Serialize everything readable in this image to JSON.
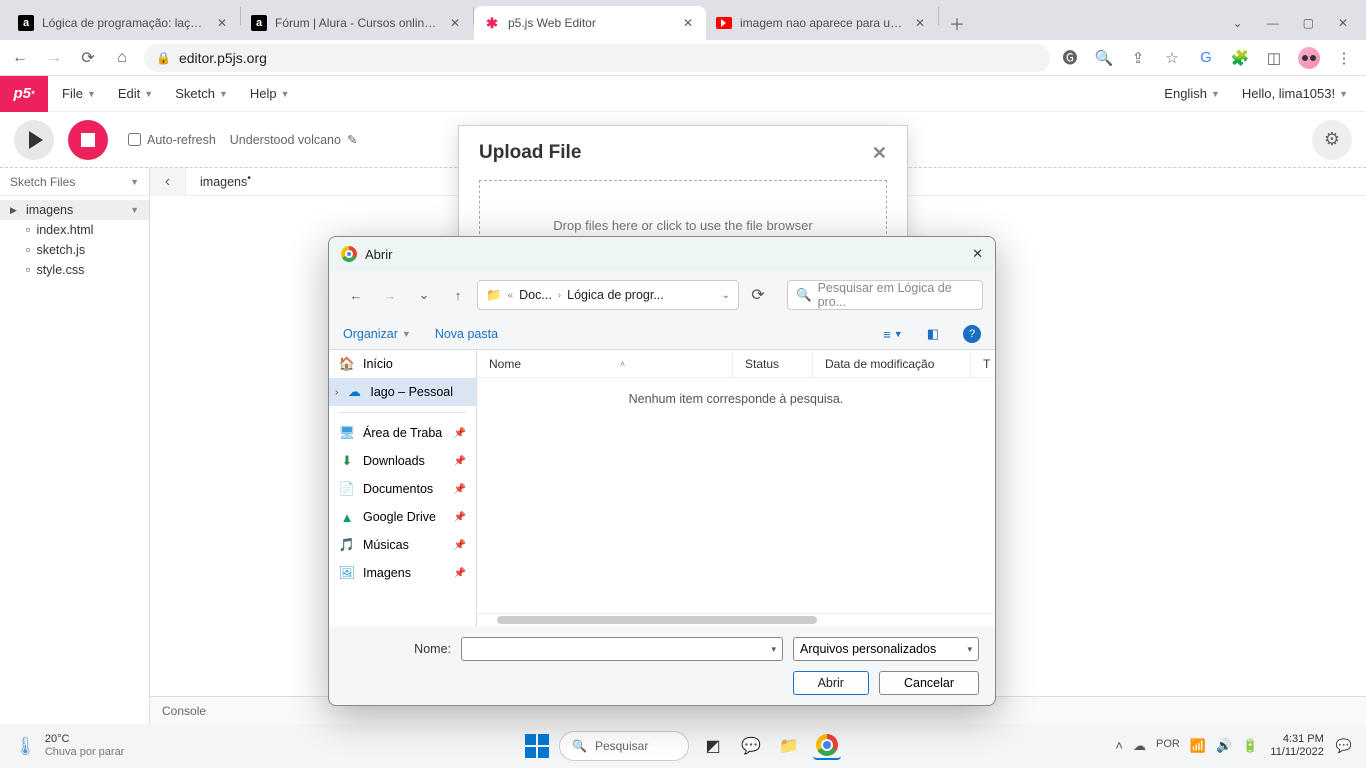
{
  "chrome": {
    "tabs": [
      {
        "title": "Lógica de programação: laços e l",
        "fav": "a"
      },
      {
        "title": "Fórum | Alura - Cursos online de",
        "fav": "a"
      },
      {
        "title": "p5.js Web Editor",
        "fav": "p5"
      },
      {
        "title": "imagem nao aparece para uploa",
        "fav": "yt"
      }
    ],
    "url": "editor.p5js.org"
  },
  "p5": {
    "menus": [
      "File",
      "Edit",
      "Sketch",
      "Help"
    ],
    "lang": "English",
    "greeting": "Hello, lima1053!",
    "autorefresh": "Auto-refresh",
    "sketch_name": "Understood volcano",
    "sidebar_title": "Sketch Files",
    "files": [
      "imagens",
      "index.html",
      "sketch.js",
      "style.css"
    ],
    "open_tab": "imagens",
    "console": "Console"
  },
  "upload": {
    "title": "Upload File",
    "hint": "Drop files here or click to use the file browser"
  },
  "dialog": {
    "title": "Abrir",
    "breadcrumb": {
      "p1": "Doc...",
      "p2": "Lógica de progr..."
    },
    "search_placeholder": "Pesquisar em Lógica de pro...",
    "organizar": "Organizar",
    "novapasta": "Nova pasta",
    "cols": {
      "name": "Nome",
      "status": "Status",
      "date": "Data de modificação",
      "t": "T"
    },
    "empty": "Nenhum item corresponde à pesquisa.",
    "side": [
      {
        "label": "Início",
        "ico": "home"
      },
      {
        "label": "Iago – Pessoal",
        "ico": "cloud",
        "sel": true
      },
      {
        "label": "Área de Traba",
        "ico": "desk",
        "pin": true
      },
      {
        "label": "Downloads",
        "ico": "down",
        "pin": true
      },
      {
        "label": "Documentos",
        "ico": "doc",
        "pin": true
      },
      {
        "label": "Google Drive",
        "ico": "gdrive",
        "pin": true
      },
      {
        "label": "Músicas",
        "ico": "music",
        "pin": true
      },
      {
        "label": "Imagens",
        "ico": "img",
        "pin": true
      }
    ],
    "name_label": "Nome:",
    "filetype": "Arquivos personalizados",
    "open": "Abrir",
    "cancel": "Cancelar"
  },
  "taskbar": {
    "temp": "20°C",
    "cond": "Chuva por parar",
    "search": "Pesquisar",
    "lang": "POR",
    "time": "4:31 PM",
    "date": "11/11/2022"
  }
}
